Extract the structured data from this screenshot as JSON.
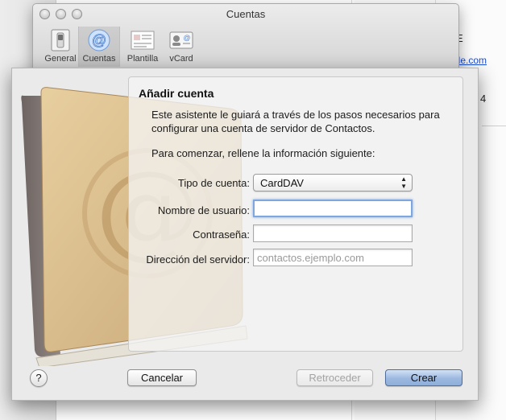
{
  "prefs_window": {
    "title": "Cuentas",
    "toolbar": [
      {
        "label": "General",
        "icon": "switch-icon"
      },
      {
        "label": "Cuentas",
        "icon": "at-sign-icon",
        "selected": true
      },
      {
        "label": "Plantilla",
        "icon": "template-icon"
      },
      {
        "label": "vCard",
        "icon": "vcard-icon"
      }
    ]
  },
  "background": {
    "link_fragment": "ple.com",
    "glyph_e": "E",
    "glyph_4": "4"
  },
  "sheet": {
    "title": "Añadir cuenta",
    "description": "Este asistente le guiará a través de los pasos necesarios para configurar una cuenta de servidor de Contactos.",
    "intro": "Para comenzar, rellene la información siguiente:",
    "fields": {
      "account_type": {
        "label": "Tipo de cuenta:",
        "value": "CardDAV"
      },
      "username": {
        "label": "Nombre de usuario:",
        "value": ""
      },
      "password": {
        "label": "Contraseña:",
        "value": ""
      },
      "server": {
        "label": "Dirección del servidor:",
        "value": "",
        "placeholder": "contactos.ejemplo.com"
      }
    },
    "buttons": {
      "help": "?",
      "cancel": "Cancelar",
      "back": "Retroceder",
      "create": "Crear"
    }
  }
}
